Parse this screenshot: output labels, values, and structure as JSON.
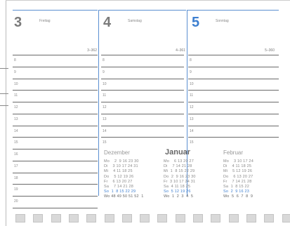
{
  "columns": [
    {
      "number": "3",
      "dayname": "Freitag",
      "doy": "3–362",
      "sunday": false
    },
    {
      "number": "4",
      "dayname": "Samstag",
      "doy": "4–361",
      "sunday": false
    },
    {
      "number": "5",
      "dayname": "Sonntag",
      "doy": "5–360",
      "sunday": true
    }
  ],
  "hours": [
    "8",
    "9",
    "10",
    "11",
    "12",
    "13",
    "14",
    "15",
    "16",
    "17",
    "18",
    "19",
    "20"
  ],
  "mini_calendar": {
    "months": [
      {
        "name": "Dezember",
        "current": false,
        "lines": [
          {
            "text": "Mo    2  9 16 23 30",
            "su": false,
            "wk": false
          },
          {
            "text": "Di    3 10 17 24 31",
            "su": false,
            "wk": false
          },
          {
            "text": "Mi    4 11 18 25",
            "su": false,
            "wk": false
          },
          {
            "text": "Do    5 12 19 26",
            "su": false,
            "wk": false
          },
          {
            "text": "Fr    6 13 20 27",
            "su": false,
            "wk": false
          },
          {
            "text": "Sa    7 14 21 28",
            "su": false,
            "wk": false
          },
          {
            "text": "So  1  8 15 22 29",
            "su": true,
            "wk": false
          },
          {
            "text": "Wo 48 49 50 51 52  1",
            "su": false,
            "wk": true
          }
        ]
      },
      {
        "name": "Januar",
        "current": true,
        "lines": [
          {
            "text": "Mo    6 13 20 27",
            "su": false,
            "wk": false
          },
          {
            "text": "Di    7 14 21 28",
            "su": false,
            "wk": false
          },
          {
            "text": "Mi  1  8 15 22 29",
            "su": false,
            "wk": false
          },
          {
            "text": "Do  2  9 16 23 30",
            "su": false,
            "wk": false
          },
          {
            "text": "Fr  3 10 17 24 31",
            "su": false,
            "wk": false
          },
          {
            "text": "Sa  4 11 18 25",
            "su": false,
            "wk": false
          },
          {
            "text": "So  5 12 19 26",
            "su": true,
            "wk": false
          },
          {
            "text": "Wo  1  2  3  4  5",
            "su": false,
            "wk": true
          }
        ]
      },
      {
        "name": "Februar",
        "current": false,
        "lines": [
          {
            "text": "Mo    3 10 17 24",
            "su": false,
            "wk": false
          },
          {
            "text": "Di    4 11 18 25",
            "su": false,
            "wk": false
          },
          {
            "text": "Mi    5 12 19 26",
            "su": false,
            "wk": false
          },
          {
            "text": "Do    6 13 20 27",
            "su": false,
            "wk": false
          },
          {
            "text": "Fr    7 14 21 28",
            "su": false,
            "wk": false
          },
          {
            "text": "Sa  1  8 15 22",
            "su": false,
            "wk": false
          },
          {
            "text": "So  2  9 16 23",
            "su": true,
            "wk": false
          },
          {
            "text": "Wo  5  6  7  8  9",
            "su": false,
            "wk": true
          }
        ]
      }
    ]
  },
  "colors": {
    "accent": "#3d7fd0",
    "rule": "#6a6a6a",
    "hole": "#d9d9d9"
  }
}
